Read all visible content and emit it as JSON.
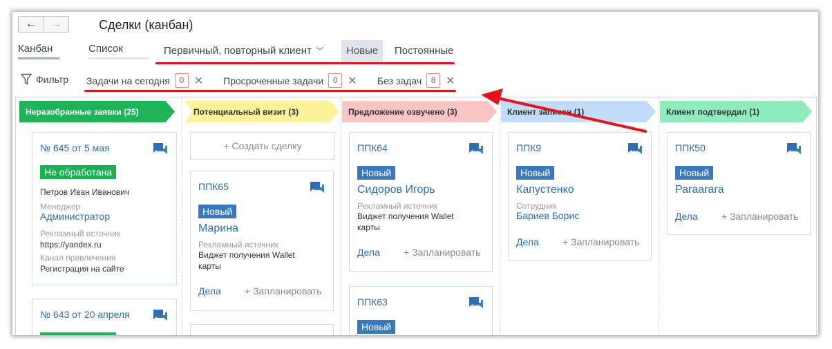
{
  "window": {
    "title": "Сделки (канбан)",
    "nav": {
      "back_icon": "←",
      "forward_icon": "→"
    }
  },
  "views": {
    "kanban": "Канбан",
    "list": "Список"
  },
  "segments": {
    "primary": "Первичный, повторный клиент",
    "primary_chevron": "﹀",
    "new": "Новые",
    "constant": "Постоянные"
  },
  "filters": {
    "label": "Фильтр",
    "chips": [
      {
        "label": "Задачи на сегодня",
        "count": "0"
      },
      {
        "label": "Просроченные задачи",
        "count": "0"
      },
      {
        "label": "Без задач",
        "count": "8"
      }
    ],
    "close_glyph": "✕"
  },
  "colors": {
    "col1": "#1cb457",
    "col2": "#fbf29a",
    "col3": "#f9c4c4",
    "col4": "#c0dcf6",
    "col5": "#8fecbd",
    "annotation_red": "#e8121b",
    "link": "#2d6fb3",
    "status_green": "#1ab152",
    "status_blue": "#3779c1"
  },
  "columns": [
    {
      "title": "Неразобранные заявки (25)"
    },
    {
      "title": "Потенциальный визит (3)"
    },
    {
      "title": "Предложение озвучено (3)"
    },
    {
      "title": "Клиент записан (1)"
    },
    {
      "title": "Клиент подтвердил (1)"
    }
  ],
  "create_deal": "+ Создать сделку",
  "cards": {
    "c1": {
      "id": "№ 645 от 5 мая",
      "status": "Не обработана",
      "person": "Петров Иван Иванович",
      "manager_label": "Менеджер",
      "manager": "Администратор",
      "source_label": "Рекламный источник",
      "source": "https://yandex.ru",
      "channel_label": "Канал привлечения",
      "channel": "Регистрация на сайте"
    },
    "c1b": {
      "id": "№ 643 от 20 апреля"
    },
    "c2": {
      "id": "ППК65",
      "status": "Новый",
      "name": "Марина",
      "source_label": "Рекламный источник",
      "source_line1": "Виджет получения Wallet",
      "source_line2": "карты",
      "tasks": "Дела",
      "plan": "+ Запланировать"
    },
    "c3": {
      "id": "ППК64",
      "status": "Новый",
      "name": "Сидоров Игорь",
      "source_label": "Рекламный источник",
      "source_line1": "Виджет получения Wallet",
      "source_line2": "карты",
      "tasks": "Дела",
      "plan": "+ Запланировать"
    },
    "c3b": {
      "id": "ППК63",
      "status": "Новый"
    },
    "c4": {
      "id": "ППК9",
      "status": "Новый",
      "name": "Капустенко",
      "employee_label": "Сотрудник",
      "employee": "Бариев Борис",
      "tasks": "Дела",
      "plan": "+ Запланировать"
    },
    "c5": {
      "id": "ППК50",
      "status": "Новый",
      "name": "Раraarara",
      "tasks": "Дела",
      "plan": "+ Запланировать"
    }
  }
}
